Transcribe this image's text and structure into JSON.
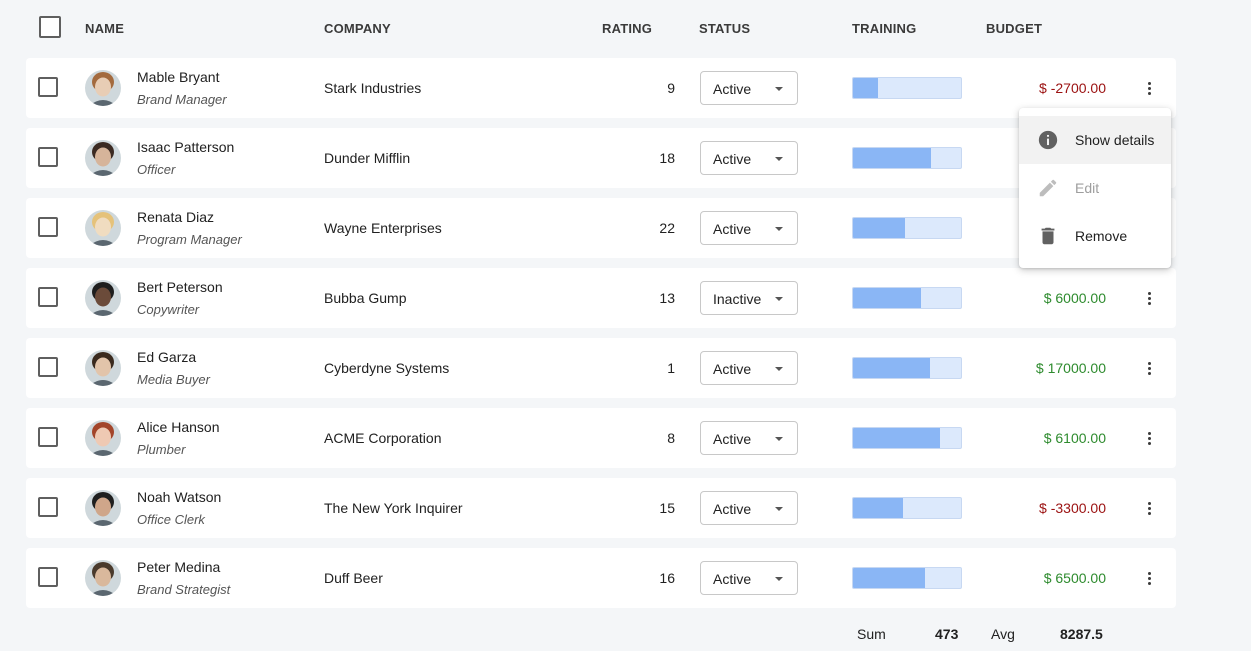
{
  "header": {
    "name": "NAME",
    "company": "COMPANY",
    "rating": "RATING",
    "status": "STATUS",
    "training": "TRAINING",
    "budget": "BUDGET"
  },
  "rows": [
    {
      "name": "Mable Bryant",
      "title": "Brand Manager",
      "company": "Stark Industries",
      "rating": "9",
      "status": "Active",
      "training": 0.23,
      "budget": "$ -2700.00",
      "budget_sign": "neg"
    },
    {
      "name": "Isaac Patterson",
      "title": "Officer",
      "company": "Dunder Mifflin",
      "rating": "18",
      "status": "Active",
      "training": 0.72,
      "budget": "",
      "budget_sign": "pos"
    },
    {
      "name": "Renata Diaz",
      "title": "Program Manager",
      "company": "Wayne Enterprises",
      "rating": "22",
      "status": "Active",
      "training": 0.48,
      "budget": "",
      "budget_sign": "pos"
    },
    {
      "name": "Bert Peterson",
      "title": "Copywriter",
      "company": "Bubba Gump",
      "rating": "13",
      "status": "Inactive",
      "training": 0.63,
      "budget": "$ 6000.00",
      "budget_sign": "pos"
    },
    {
      "name": "Ed Garza",
      "title": "Media Buyer",
      "company": "Cyberdyne Systems",
      "rating": "1",
      "status": "Active",
      "training": 0.71,
      "budget": "$ 17000.00",
      "budget_sign": "pos"
    },
    {
      "name": "Alice Hanson",
      "title": "Plumber",
      "company": "ACME Corporation",
      "rating": "8",
      "status": "Active",
      "training": 0.81,
      "budget": "$ 6100.00",
      "budget_sign": "pos"
    },
    {
      "name": "Noah Watson",
      "title": "Office Clerk",
      "company": "The New York Inquirer",
      "rating": "15",
      "status": "Active",
      "training": 0.46,
      "budget": "$ -3300.00",
      "budget_sign": "neg"
    },
    {
      "name": "Peter Medina",
      "title": "Brand Strategist",
      "company": "Duff Beer",
      "rating": "16",
      "status": "Active",
      "training": 0.67,
      "budget": "$ 6500.00",
      "budget_sign": "pos"
    }
  ],
  "menu": {
    "items": [
      {
        "label": "Show details",
        "icon": "info-icon",
        "state": "hover"
      },
      {
        "label": "Edit",
        "icon": "pencil-icon",
        "state": "disabled"
      },
      {
        "label": "Remove",
        "icon": "trash-icon",
        "state": "normal"
      }
    ]
  },
  "footer": {
    "sum_label": "Sum",
    "sum_value": "473",
    "avg_label": "Avg",
    "avg_value": "8287.5"
  },
  "colors": {
    "negative": "#9b1111",
    "positive": "#2e8b2e",
    "progress_fill": "#8ab6f5",
    "progress_track": "#dce9fc"
  }
}
